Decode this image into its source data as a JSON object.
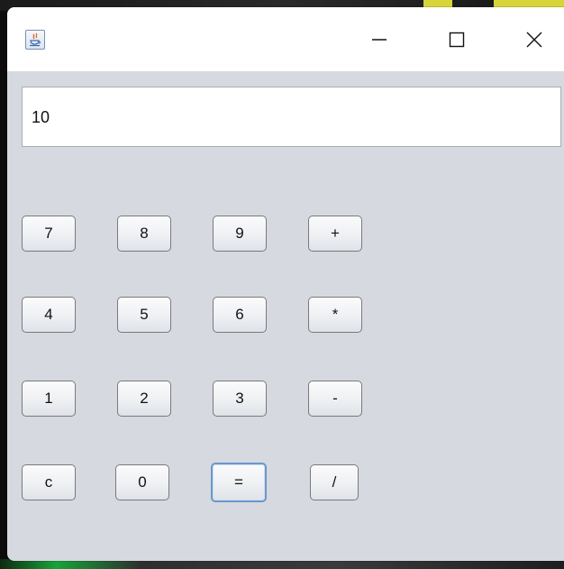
{
  "window": {
    "title": "",
    "display_value": "10"
  },
  "titlebar": {
    "minimize_symbol": "—",
    "maximize_symbol": "☐",
    "close_symbol": "✕"
  },
  "keys": {
    "k7": "7",
    "k8": "8",
    "k9": "9",
    "kplus": "+",
    "k4": "4",
    "k5": "5",
    "k6": "6",
    "kmul": "*",
    "k1": "1",
    "k2": "2",
    "k3": "3",
    "kminus": "-",
    "kc": "c",
    "k0": "0",
    "keq": "=",
    "kdiv": "/"
  },
  "focused_key": "=",
  "icons": {
    "app": "java-coffee-icon",
    "minimize": "minimize-icon",
    "maximize": "maximize-icon",
    "close": "close-icon"
  }
}
